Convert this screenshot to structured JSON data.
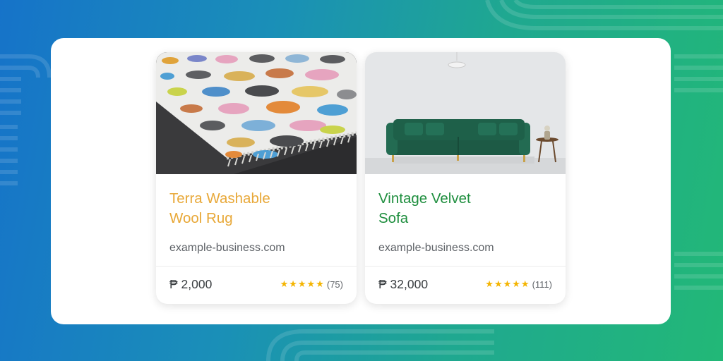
{
  "colors": {
    "rug_title": "#e8a838",
    "sofa_title": "#1e8e3e",
    "star": "#f4b400"
  },
  "products": [
    {
      "title_line1": "Terra Washable",
      "title_line2": "Wool Rug",
      "domain": "example-business.com",
      "price": "₱ 2,000",
      "stars": "★★★★★",
      "rating_count": "(75)",
      "image": "rug-photo"
    },
    {
      "title_line1": "Vintage Velvet",
      "title_line2": "Sofa",
      "domain": "example-business.com",
      "price": "₱ 32,000",
      "stars": "★★★★★",
      "rating_count": "(111)",
      "image": "sofa-photo"
    }
  ]
}
